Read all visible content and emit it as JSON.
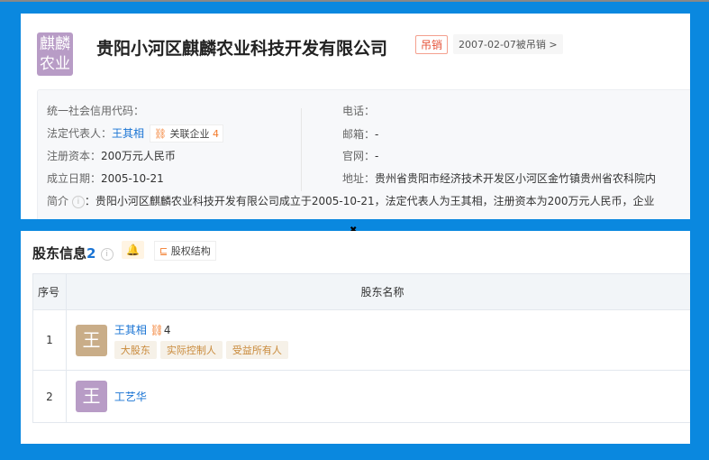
{
  "company": {
    "logo_text": [
      "麒麟",
      "农业"
    ],
    "logo_color": "#b89cc6",
    "name": "贵阳小河区麒麟农业科技开发有限公司",
    "status": "吊销",
    "status_date": "2007-02-07被吊销 >"
  },
  "info": {
    "credit_code_label": "统一社会信用代码：",
    "legal_rep_label": "法定代表人：",
    "legal_rep": "王其相",
    "related_label": "关联企业",
    "related_count": "4",
    "capital_label": "注册资本：",
    "capital": "200万元人民币",
    "founded_label": "成立日期：",
    "founded": "2005-10-21",
    "phone_label": "电话：",
    "email_label": "邮箱：",
    "email": "-",
    "web_label": "官网：",
    "web": "-",
    "address_label": "地址：",
    "address": "贵州省贵阳市经济技术开发区小河区金竹镇贵州省农科院内",
    "intro_label": "简介",
    "intro": "：贵阳小河区麒麟农业科技开发有限公司成立于2005-10-21，法定代表人为王其相，注册资本为200万元人民币，企业"
  },
  "shareholders": {
    "title": "股东信息",
    "count": "2",
    "equity_label": "股权结构",
    "columns": [
      "序号",
      "股东名称"
    ],
    "rows": [
      {
        "no": "1",
        "avatar": "王",
        "avatar_color": "#c9ad88",
        "name": "王其相",
        "related_count": "4",
        "tags": [
          "大股东",
          "实际控制人",
          "受益所有人"
        ]
      },
      {
        "no": "2",
        "avatar": "王",
        "avatar_color": "#b89cc6",
        "name": "工艺华"
      }
    ]
  },
  "colors": {
    "background": "#0a88df",
    "link": "#1a74d4",
    "accent": "#f27a2a"
  }
}
